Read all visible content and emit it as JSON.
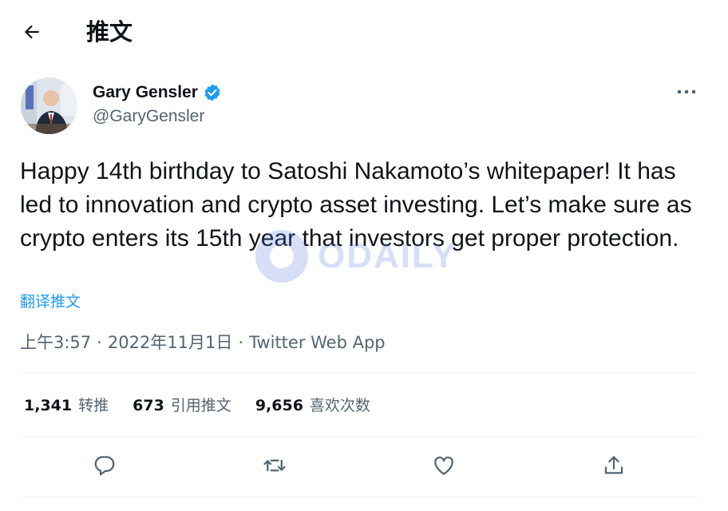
{
  "header": {
    "title": "推文"
  },
  "author": {
    "name": "Gary Gensler",
    "handle": "@GaryGensler",
    "verified": true
  },
  "tweet": {
    "text": "Happy 14th birthday to Satoshi Nakamoto’s whitepaper! It has led to innovation and crypto asset investing. Let’s make sure as crypto enters its 15th year that investors get proper protection.",
    "translate_label": "翻译推文"
  },
  "meta": {
    "time": "上午3:57",
    "separator": "·",
    "date": "2022年11月1日",
    "source": "Twitter Web App"
  },
  "stats": [
    {
      "count": "1,341",
      "label": "转推"
    },
    {
      "count": "673",
      "label": "引用推文"
    },
    {
      "count": "9,656",
      "label": "喜欢次数"
    }
  ],
  "actions": [
    "reply-icon",
    "retweet-icon",
    "like-icon",
    "share-icon"
  ],
  "watermark": "ODAILY",
  "colors": {
    "accent": "#1d9bf0",
    "secondary_text": "#536471",
    "divider": "#eff3f4"
  }
}
